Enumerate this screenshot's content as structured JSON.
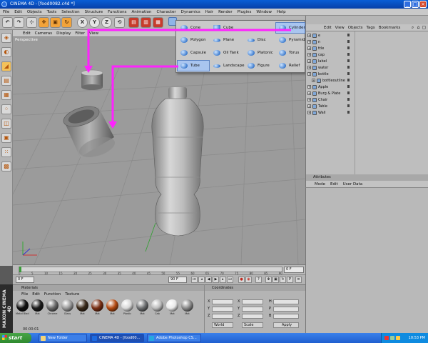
{
  "window": {
    "title": "CINEMA 4D - [food0082.c4d *]"
  },
  "menu": [
    "File",
    "Edit",
    "Objects",
    "Tools",
    "Selection",
    "Structure",
    "Functions",
    "Animation",
    "Character",
    "Dynamics",
    "Hair",
    "Render",
    "Plugins",
    "Window",
    "Help"
  ],
  "toolbar": {
    "undo_icon": "undo-arrow-icon",
    "redo_icon": "redo-arrow-icon",
    "axis_x": "X",
    "axis_y": "Y",
    "axis_z": "Z"
  },
  "viewport": {
    "menu": [
      "Edit",
      "Cameras",
      "Display",
      "Filter",
      "View"
    ],
    "label": "Perspective"
  },
  "primitives_menu": {
    "items": [
      {
        "label": "Cone"
      },
      {
        "label": "Cube"
      },
      {
        "label": "Cylinder"
      },
      {
        "label": "Polygon"
      },
      {
        "label": "Plane"
      },
      {
        "label": "Disc"
      },
      {
        "label": "Pyramid"
      },
      {
        "label": "Capsule"
      },
      {
        "label": "Oil Tank"
      },
      {
        "label": "Platonic"
      },
      {
        "label": "Torus"
      },
      {
        "label": "Tube"
      },
      {
        "label": "Landscape"
      },
      {
        "label": "Figure"
      },
      {
        "label": "Relief"
      }
    ]
  },
  "object_manager": {
    "menu": [
      "Edit",
      "View",
      "Objects",
      "Tags",
      "Bookmarks"
    ],
    "objects": [
      {
        "name": "e"
      },
      {
        "name": "n"
      },
      {
        "name": "ttle"
      },
      {
        "name": "cap"
      },
      {
        "name": "label"
      },
      {
        "name": "water"
      },
      {
        "name": "bottle"
      },
      {
        "name": "bottleoutline"
      },
      {
        "name": "Apple"
      },
      {
        "name": "Burg & Plate"
      },
      {
        "name": "Chair"
      },
      {
        "name": "Table"
      },
      {
        "name": "Wall"
      }
    ]
  },
  "attributes": {
    "title": "Attributes",
    "menu": [
      "Mode",
      "Edit",
      "User Data"
    ]
  },
  "timeline": {
    "ticks": [
      "0",
      "5",
      "10",
      "15",
      "20",
      "25",
      "30",
      "35",
      "40",
      "45",
      "50",
      "55",
      "60",
      "65",
      "70",
      "75",
      "80",
      "85",
      "90"
    ],
    "current_frame": "0 F",
    "start_field": "0 F",
    "end_field": "90 F"
  },
  "materials": {
    "title": "Materials",
    "menu": [
      "File",
      "Edit",
      "Function",
      "Texture"
    ],
    "items": [
      {
        "name": "Metal Black",
        "color": "#111111"
      },
      {
        "name": "Mat",
        "color": "#1c1c1c"
      },
      {
        "name": "Chrome",
        "color": "#6a6a6a"
      },
      {
        "name": "Glass",
        "color": "#9a9a9a"
      },
      {
        "name": "Mat",
        "color": "#3a2a1a"
      },
      {
        "name": "Mat",
        "color": "#7a2f14"
      },
      {
        "name": "Mat",
        "color": "#b34a12"
      },
      {
        "name": "Plastic",
        "color": "#d8d8d8"
      },
      {
        "name": "Mat",
        "color": "#6e7072"
      },
      {
        "name": "Cab",
        "color": "#bcbcbc"
      },
      {
        "name": "Mat",
        "color": "#e9e9e9"
      },
      {
        "name": "Mat",
        "color": "#8a8a8a"
      }
    ],
    "time_readout": "00:00:01"
  },
  "coordinates": {
    "title": "Coordinates",
    "axes": [
      "X",
      "Y",
      "Z"
    ],
    "rot_axes": [
      "H",
      "P",
      "B"
    ],
    "mode_select": "World",
    "scale_select": "Scale",
    "apply_label": "Apply"
  },
  "maxon": {
    "text": "MAXON CINEMA 4D"
  },
  "taskbar": {
    "start_label": "start",
    "tasks": [
      {
        "label": "New Folder",
        "active": false
      },
      {
        "label": "CINEMA 4D - [food00...",
        "active": true
      },
      {
        "label": "Adobe Photoshop CS...",
        "active": false
      }
    ],
    "clock": "10:53 PM"
  },
  "annotation_color": "#ff22ff"
}
